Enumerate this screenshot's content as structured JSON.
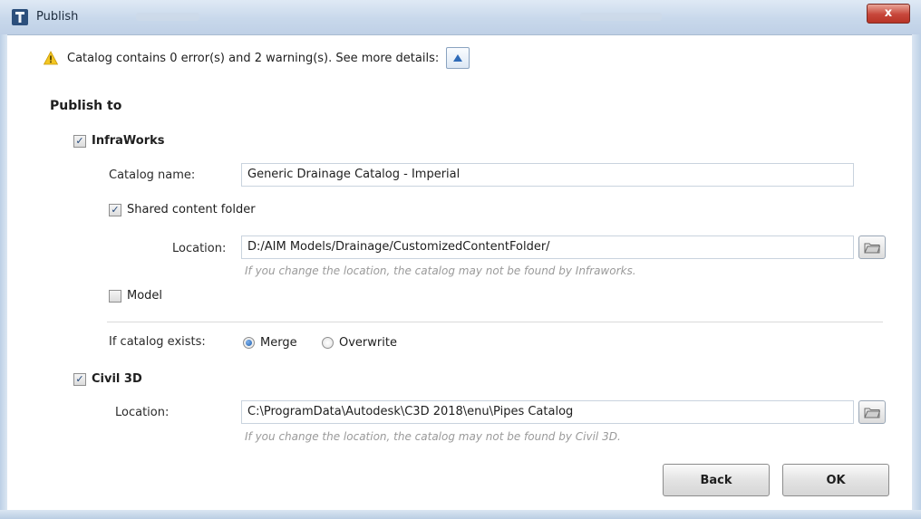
{
  "window": {
    "title": "Publish",
    "close_label": "x"
  },
  "warning": {
    "text": "Catalog contains 0 error(s) and 2 warning(s). See more details:"
  },
  "publish_to": {
    "title": "Publish to",
    "infraworks": {
      "label": "InfraWorks",
      "checked": true,
      "catalog_name_label": "Catalog name:",
      "catalog_name_value": "Generic Drainage Catalog - Imperial",
      "shared_folder_label": "Shared content folder",
      "shared_folder_checked": true,
      "location_label": "Location:",
      "location_value": "D:/AIM Models/Drainage/CustomizedContentFolder/",
      "location_hint": "If you change the location, the catalog may not be found by Infraworks.",
      "model_label": "Model",
      "model_checked": false,
      "exists_label": "If catalog exists:",
      "merge_label": "Merge",
      "overwrite_label": "Overwrite",
      "selected_option": "Merge"
    },
    "civil3d": {
      "label": "Civil 3D",
      "checked": true,
      "location_label": "Location:",
      "location_value": "C:\\ProgramData\\Autodesk\\C3D 2018\\enu\\Pipes Catalog",
      "location_hint": "If you change the location, the catalog may not be found by Civil 3D."
    }
  },
  "buttons": {
    "back": "Back",
    "ok": "OK"
  },
  "icons": {
    "app": "autodesk-icon",
    "warning": "warning-icon",
    "expand": "chevron-up-icon",
    "browse": "folder-browse-icon"
  }
}
